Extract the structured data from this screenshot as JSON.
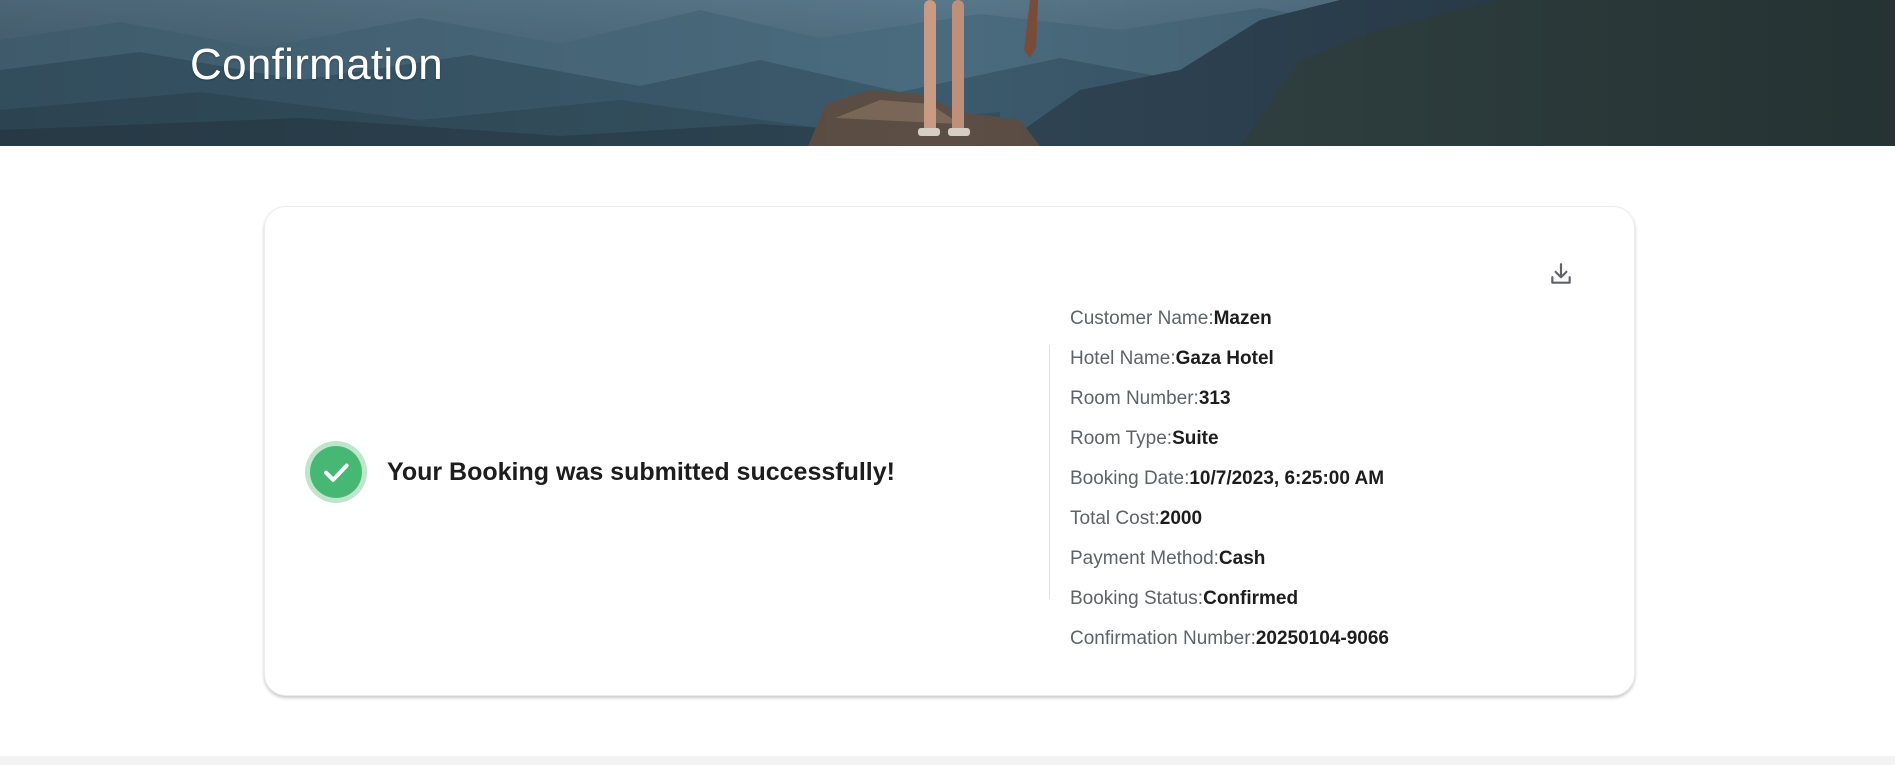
{
  "hero": {
    "title": "Confirmation"
  },
  "confirmation": {
    "message": "Your Booking was submitted successfully!",
    "download_icon": "download-icon",
    "success_icon": "check-circle-icon",
    "success_color": "#47b874",
    "details": [
      {
        "label": "Customer Name:",
        "value": "Mazen"
      },
      {
        "label": "Hotel Name:",
        "value": "Gaza Hotel"
      },
      {
        "label": "Room Number:",
        "value": "313"
      },
      {
        "label": "Room Type:",
        "value": "Suite"
      },
      {
        "label": "Booking Date:",
        "value": "10/7/2023, 6:25:00 AM"
      },
      {
        "label": "Total Cost:",
        "value": "2000"
      },
      {
        "label": "Payment Method:",
        "value": "Cash"
      },
      {
        "label": "Booking Status:",
        "value": "Confirmed"
      },
      {
        "label": "Confirmation Number:",
        "value": "20250104-9066"
      }
    ]
  }
}
